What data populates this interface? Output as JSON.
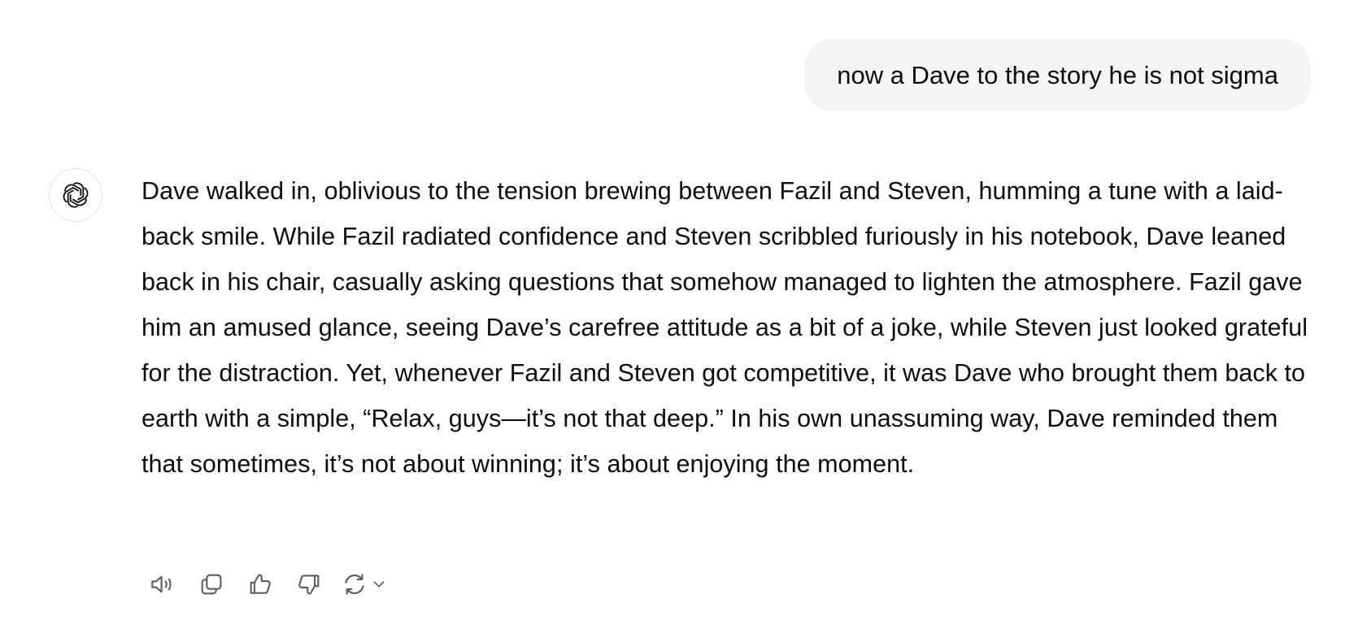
{
  "user_message": {
    "text": "now a Dave to the story he is not sigma"
  },
  "assistant_message": {
    "avatar_icon": "openai-logo-icon",
    "text": "Dave walked in, oblivious to the tension brewing between Fazil and Steven, humming a tune with a laid-back smile. While Fazil radiated confidence and Steven scribbled furiously in his notebook, Dave leaned back in his chair, casually asking questions that somehow managed to lighten the atmosphere. Fazil gave him an amused glance, seeing Dave’s carefree attitude as a bit of a joke, while Steven just looked grateful for the distraction. Yet, whenever Fazil and Steven got competitive, it was Dave who brought them back to earth with a simple, “Relax, guys—it’s not that deep.” In his own unassuming way, Dave reminded them that sometimes, it’s not about winning; it’s about enjoying the moment."
  },
  "actions": [
    {
      "icon": "speaker-icon"
    },
    {
      "icon": "copy-icon"
    },
    {
      "icon": "thumbs-up-icon"
    },
    {
      "icon": "thumbs-down-icon"
    },
    {
      "icon": "regenerate-icon"
    }
  ],
  "colors": {
    "user_bubble_bg": "#f4f4f4",
    "text": "#0d0d0d",
    "icon": "#5d5d5d"
  }
}
